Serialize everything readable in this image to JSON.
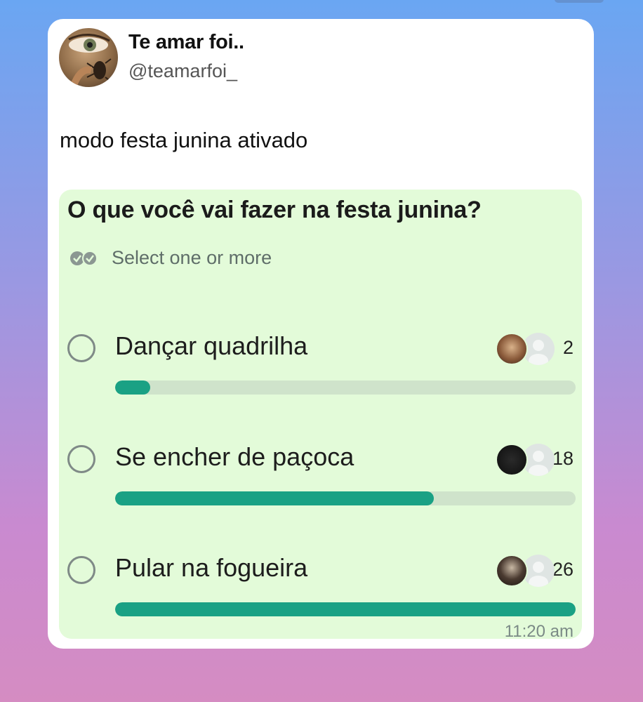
{
  "post": {
    "display_name": "Te amar foi..",
    "handle": "@teamarfoi_",
    "text": "modo festa junina ativado"
  },
  "poll": {
    "question": "O que você vai fazer na festa junina?",
    "select_label": "Select one or more",
    "select_icon": "double-check-icon",
    "timestamp": "11:20 am",
    "accent_color": "#1aa184",
    "background_color": "#e3fbd9",
    "max_votes": 26,
    "options": [
      {
        "label": "Dançar quadrilha",
        "votes": 2,
        "count_label": "2"
      },
      {
        "label": "Se encher de paçoca",
        "votes": 18,
        "count_label": "18"
      },
      {
        "label": "Pular na fogueira",
        "votes": 26,
        "count_label": "26"
      }
    ]
  }
}
